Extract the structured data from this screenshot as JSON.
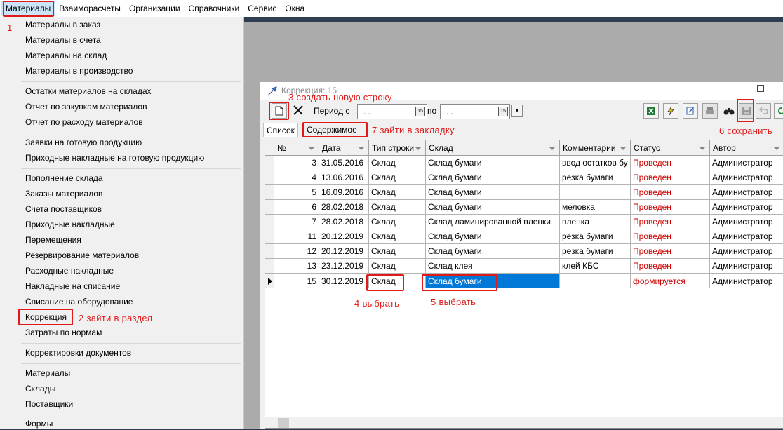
{
  "menubar": {
    "items": [
      "Материалы",
      "Взаиморасчеты",
      "Организации",
      "Справочники",
      "Сервис",
      "Окна"
    ]
  },
  "dropdown": {
    "items": [
      "Материалы в заказ",
      "Материалы в счета",
      "Материалы на склад",
      "Материалы в производство",
      "Остатки материалов на складах",
      "Отчет по закупкам материалов",
      "Отчет по расходу материалов",
      "Заявки на готовую продукцию",
      "Приходные накладные на готовую продукцию",
      "Пополнение склада",
      "Заказы материалов",
      "Счета поставщиков",
      "Приходные накладные",
      "Перемещения",
      "Резервирование материалов",
      "Расходные накладные",
      "Накладные на списание",
      "Списание на оборудование",
      "Коррекция",
      "Затраты по нормам",
      "Корректировки документов",
      "Материалы",
      "Склады",
      "Поставщики",
      "Формы"
    ]
  },
  "window": {
    "title": "Коррекция: 15",
    "toolbar": {
      "period_from_label": "Период с",
      "period_to_label": "по",
      "date_from": " .  .",
      "date_to": " .  .",
      "cal_glyph": "15"
    },
    "tabs": [
      "Список",
      "Содержимое"
    ],
    "grid": {
      "columns": [
        "№",
        "Дата",
        "Тип строки",
        "Склад",
        "Комментарии",
        "Статус",
        "Автор"
      ],
      "rows": [
        {
          "n": "3",
          "date": "31.05.2016",
          "type": "Склад",
          "store": "Склад бумаги",
          "comment": "ввод остатков бу",
          "status": "Проведен",
          "author": "Администратор"
        },
        {
          "n": "4",
          "date": "13.06.2016",
          "type": "Склад",
          "store": "Склад бумаги",
          "comment": "резка бумаги",
          "status": "Проведен",
          "author": "Администратор"
        },
        {
          "n": "5",
          "date": "16.09.2016",
          "type": "Склад",
          "store": "Склад бумаги",
          "comment": "",
          "status": "Проведен",
          "author": "Администратор"
        },
        {
          "n": "6",
          "date": "28.02.2018",
          "type": "Склад",
          "store": "Склад бумаги",
          "comment": "меловка",
          "status": "Проведен",
          "author": "Администратор"
        },
        {
          "n": "7",
          "date": "28.02.2018",
          "type": "Склад",
          "store": "Склад ламинированной пленки",
          "comment": "пленка",
          "status": "Проведен",
          "author": "Администратор"
        },
        {
          "n": "11",
          "date": "20.12.2019",
          "type": "Склад",
          "store": "Склад бумаги",
          "comment": "резка бумаги",
          "status": "Проведен",
          "author": "Администратор"
        },
        {
          "n": "12",
          "date": "20.12.2019",
          "type": "Склад",
          "store": "Склад бумаги",
          "comment": "резка бумаги",
          "status": "Проведен",
          "author": "Администратор"
        },
        {
          "n": "13",
          "date": "23.12.2019",
          "type": "Склад",
          "store": "Склад клея",
          "comment": "клей КБС",
          "status": "Проведен",
          "author": "Администратор"
        },
        {
          "n": "15",
          "date": "30.12.2019",
          "type": "Склад",
          "store": "Склад бумаги",
          "comment": "",
          "status": "формируется",
          "author": "Администратор"
        }
      ]
    }
  },
  "annotations": {
    "a1": "1",
    "a2": "2  зайти в раздел",
    "a3": "3 создать новую строку",
    "a4": "4  выбрать",
    "a5": "5  выбрать",
    "a6": "6  сохранить",
    "a7": "7  зайти в закладку"
  },
  "colors": {
    "annotation": "#e01919",
    "status_red": "#d10000",
    "selection": "#0078d7"
  }
}
